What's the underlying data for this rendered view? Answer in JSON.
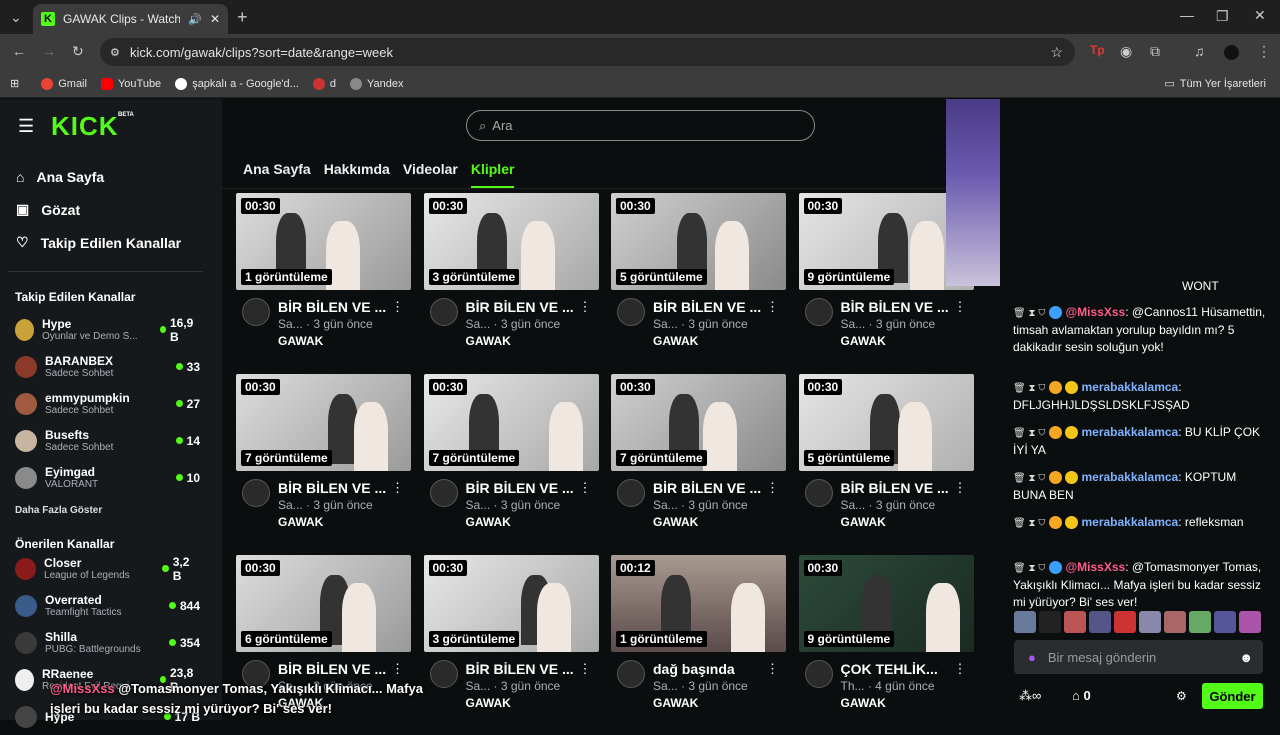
{
  "browser": {
    "tab_title": "GAWAK Clips - Watch Live o",
    "url": "kick.com/gawak/clips?sort=date&range=week",
    "bookmarks": [
      "Gmail",
      "YouTube",
      "şapkalı a - Google'd...",
      "d",
      "Yandex"
    ],
    "all_bookmarks": "Tüm Yer İşaretleri"
  },
  "site": {
    "logo": "KICK",
    "beta": "BETA",
    "search_placeholder": "Ara"
  },
  "nav": [
    "Ana Sayfa",
    "Gözat",
    "Takip Edilen Kanallar"
  ],
  "followed": {
    "heading": "Takip Edilen Kanallar",
    "show_more": "Daha Fazla Göster",
    "channels": [
      {
        "name": "Hype",
        "game": "Oyunlar ve Demo S...",
        "count": "16,9 B"
      },
      {
        "name": "BARANBEX",
        "game": "Sadece Sohbet",
        "count": "33"
      },
      {
        "name": "emmypumpkin",
        "game": "Sadece Sohbet",
        "count": "27"
      },
      {
        "name": "Busefts",
        "game": "Sadece Sohbet",
        "count": "14"
      },
      {
        "name": "Eyimgad",
        "game": "VALORANT",
        "count": "10"
      }
    ]
  },
  "recommended": {
    "heading": "Önerilen Kanallar",
    "channels": [
      {
        "name": "Closer",
        "game": "League of Legends",
        "count": "3,2 B"
      },
      {
        "name": "Overrated",
        "game": "Teamfight Tactics",
        "count": "844"
      },
      {
        "name": "Shilla",
        "game": "PUBG: Battlegrounds",
        "count": "354"
      },
      {
        "name": "RRaenee",
        "game": "Resident Evil Requi...",
        "count": "23,8 B"
      },
      {
        "name": "Hype",
        "game": "",
        "count": "17 B"
      }
    ]
  },
  "channel_tabs": [
    "Ana Sayfa",
    "Hakkımda",
    "Videolar",
    "Klipler"
  ],
  "clips": [
    {
      "dur": "00:30",
      "views": "1 görüntüleme",
      "title": "BİR BİLEN VE ...",
      "sub": "Sa... · 3 gün önce",
      "ch": "GAWAK"
    },
    {
      "dur": "00:30",
      "views": "3 görüntüleme",
      "title": "BİR BİLEN VE ...",
      "sub": "Sa... · 3 gün önce",
      "ch": "GAWAK"
    },
    {
      "dur": "00:30",
      "views": "5 görüntüleme",
      "title": "BİR BİLEN VE ...",
      "sub": "Sa... · 3 gün önce",
      "ch": "GAWAK"
    },
    {
      "dur": "00:30",
      "views": "9 görüntüleme",
      "title": "BİR BİLEN VE ...",
      "sub": "Sa... · 3 gün önce",
      "ch": "GAWAK"
    },
    {
      "dur": "00:30",
      "views": "7 görüntüleme",
      "title": "BİR BİLEN VE ...",
      "sub": "Sa... · 3 gün önce",
      "ch": "GAWAK"
    },
    {
      "dur": "00:30",
      "views": "7 görüntüleme",
      "title": "BİR BİLEN VE ...",
      "sub": "Sa... · 3 gün önce",
      "ch": "GAWAK"
    },
    {
      "dur": "00:30",
      "views": "7 görüntüleme",
      "title": "BİR BİLEN VE ...",
      "sub": "Sa... · 3 gün önce",
      "ch": "GAWAK"
    },
    {
      "dur": "00:30",
      "views": "5 görüntüleme",
      "title": "BİR BİLEN VE ...",
      "sub": "Sa... · 3 gün önce",
      "ch": "GAWAK"
    },
    {
      "dur": "00:30",
      "views": "6 görüntüleme",
      "title": "BİR BİLEN VE ...",
      "sub": "Sa... · 3 gün önce",
      "ch": "GAWAK"
    },
    {
      "dur": "00:30",
      "views": "3 görüntüleme",
      "title": "BİR BİLEN VE ...",
      "sub": "Sa... · 3 gün önce",
      "ch": "GAWAK"
    },
    {
      "dur": "00:12",
      "views": "1 görüntüleme",
      "title": "dağ başında",
      "sub": "Sa... · 3 gün önce",
      "ch": "GAWAK"
    },
    {
      "dur": "00:30",
      "views": "9 görüntüleme",
      "title": "ÇOK TEHLİK...",
      "sub": "Th... · 4 gün önce",
      "ch": "GAWAK"
    }
  ],
  "chat": {
    "messages": [
      {
        "user": "@MissXss",
        "text": ": @Cannos11 Hüsamettin, timsah avlamaktan yorulup bayıldın mı? 5 dakikadır sesin soluğun yok!",
        "color": "#ff5c8a"
      },
      {
        "user": "merabakkalamca",
        "text": ": DFLJGHHJLDŞSLDSKLFJSŞAD",
        "color": "#7fb2ff"
      },
      {
        "user": "merabakkalamca",
        "text": ": BU KLİP ÇOK İYİ YA",
        "color": "#7fb2ff"
      },
      {
        "user": "merabakkalamca",
        "text": ": KOPTUM BUNA BEN",
        "color": "#7fb2ff"
      },
      {
        "user": "merabakkalamca",
        "text": ": refleksman",
        "color": "#7fb2ff"
      },
      {
        "user": "@MissXss",
        "text": ": @Tomasmonyer Tomas, Yakışıklı Klimacı... Mafya işleri bu kadar sessiz mi yürüyor? Bi' ses ver!",
        "color": "#ff5c8a"
      }
    ],
    "input_placeholder": "Bir mesaj gönderin",
    "points": "0",
    "send": "Gönder",
    "top_cut": "WONT"
  },
  "overlay": {
    "user": "@MissXss",
    "text": "@Tomasmonyer Tomas, Yakışıklı Klimacı... Mafya işleri bu kadar sessiz mi yürüyor? Bi' ses ver!"
  }
}
